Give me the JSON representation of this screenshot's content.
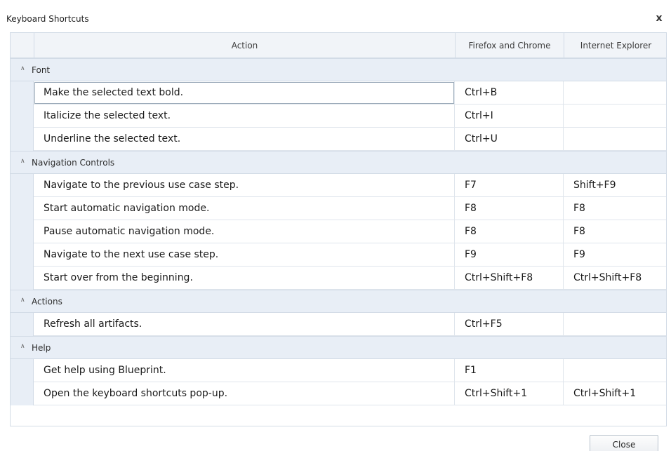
{
  "dialog": {
    "title": "Keyboard Shortcuts",
    "close_glyph": "x"
  },
  "columns": {
    "action": "Action",
    "firefox_chrome": "Firefox and Chrome",
    "ie": "Internet Explorer"
  },
  "groups": [
    {
      "label": "Font",
      "rows": [
        {
          "action": "Make the selected text bold.",
          "ff": "Ctrl+B",
          "ie": ""
        },
        {
          "action": "Italicize the selected text.",
          "ff": "Ctrl+I",
          "ie": ""
        },
        {
          "action": "Underline the selected text.",
          "ff": "Ctrl+U",
          "ie": ""
        }
      ]
    },
    {
      "label": "Navigation Controls",
      "rows": [
        {
          "action": "Navigate to the previous use case step.",
          "ff": "F7",
          "ie": "Shift+F9"
        },
        {
          "action": "Start automatic navigation mode.",
          "ff": "F8",
          "ie": "F8"
        },
        {
          "action": "Pause automatic navigation mode.",
          "ff": "F8",
          "ie": "F8"
        },
        {
          "action": "Navigate to the next use case step.",
          "ff": "F9",
          "ie": "F9"
        },
        {
          "action": "Start over from the beginning.",
          "ff": "Ctrl+Shift+F8",
          "ie": "Ctrl+Shift+F8"
        }
      ]
    },
    {
      "label": "Actions",
      "rows": [
        {
          "action": "Refresh all artifacts.",
          "ff": "Ctrl+F5",
          "ie": ""
        }
      ]
    },
    {
      "label": "Help",
      "rows": [
        {
          "action": "Get help using Blueprint.",
          "ff": "F1",
          "ie": ""
        },
        {
          "action": "Open the keyboard shortcuts pop-up.",
          "ff": "Ctrl+Shift+1",
          "ie": "Ctrl+Shift+1"
        }
      ]
    }
  ],
  "footer": {
    "close_label": "Close"
  },
  "icons": {
    "group_toggle": "chevron-up-icon",
    "dialog_close": "close-icon"
  }
}
